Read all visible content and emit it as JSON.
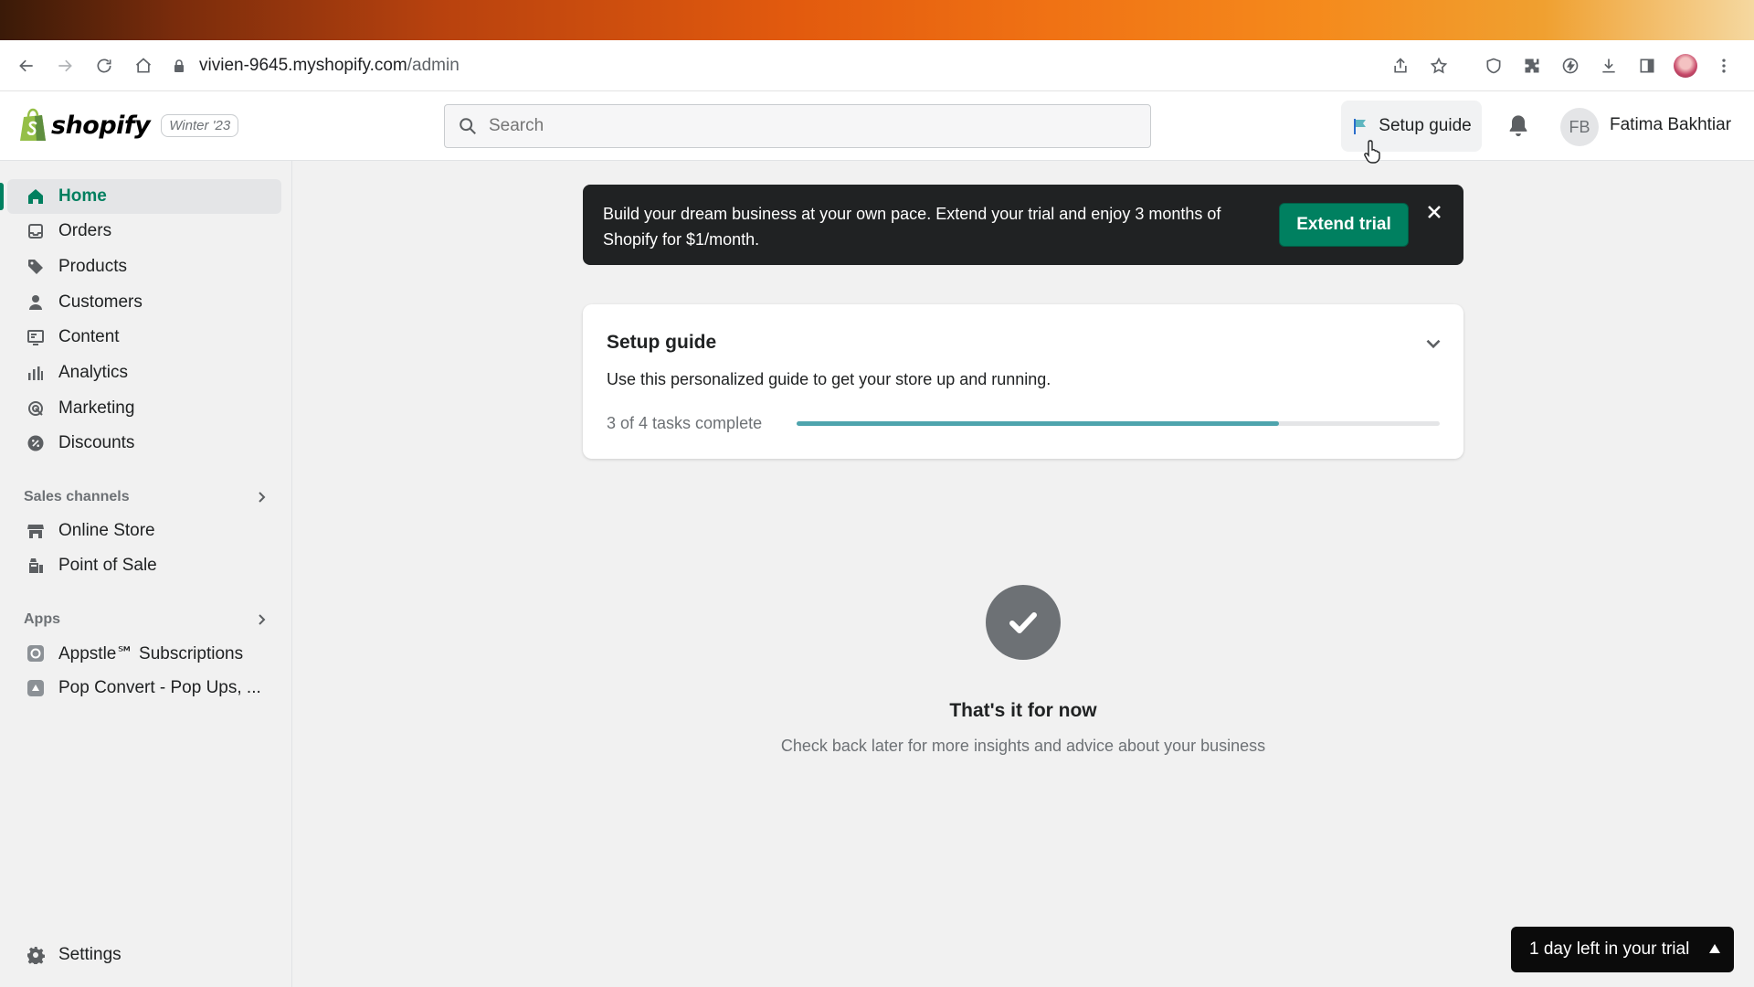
{
  "browser": {
    "url_host": "vivien-9645.myshopify.com",
    "url_path": "/admin",
    "icons": [
      "back-icon",
      "forward-icon",
      "reload-icon",
      "home-icon",
      "lock-icon",
      "share-icon",
      "star-icon",
      "shield-icon",
      "puzzle-icon",
      "lightning-icon",
      "download-icon",
      "sidebar-icon",
      "profile-avatar",
      "kebab-menu-icon"
    ]
  },
  "header": {
    "logo_text": "shopify",
    "version_badge": "Winter '23",
    "search_placeholder": "Search",
    "setup_guide_label": "Setup guide",
    "user_initials": "FB",
    "user_name": "Fatima Bakhtiar"
  },
  "sidebar": {
    "items": [
      {
        "label": "Home",
        "icon": "home-icon",
        "active": true
      },
      {
        "label": "Orders",
        "icon": "orders-icon"
      },
      {
        "label": "Products",
        "icon": "tag-icon"
      },
      {
        "label": "Customers",
        "icon": "person-icon"
      },
      {
        "label": "Content",
        "icon": "content-icon"
      },
      {
        "label": "Analytics",
        "icon": "bar-chart-icon"
      },
      {
        "label": "Marketing",
        "icon": "target-icon"
      },
      {
        "label": "Discounts",
        "icon": "discount-icon"
      }
    ],
    "sales_channels_heading": "Sales channels",
    "sales_channels": [
      {
        "label": "Online Store",
        "icon": "store-icon"
      },
      {
        "label": "Point of Sale",
        "icon": "pos-icon"
      }
    ],
    "apps_heading": "Apps",
    "apps": [
      {
        "label": "Appstle℠ Subscriptions",
        "icon": "app-icon"
      },
      {
        "label": "Pop Convert - Pop Ups, ...",
        "icon": "app-icon"
      }
    ],
    "settings_label": "Settings"
  },
  "banner": {
    "text": "Build your dream business at your own pace. Extend your trial and enjoy 3 months of Shopify for $1/month.",
    "button_label": "Extend trial"
  },
  "setup_card": {
    "title": "Setup guide",
    "description": "Use this personalized guide to get your store up and running.",
    "progress_label": "3 of 4 tasks complete",
    "progress": 0.75
  },
  "empty_state": {
    "title": "That's it for now",
    "description": "Check back later for more insights and advice about your business"
  },
  "trial_pill": {
    "label": "1 day left in your trial"
  },
  "colors": {
    "accent_green": "#008060",
    "progress_teal": "#4ea4ad",
    "banner_dark": "#202223"
  }
}
